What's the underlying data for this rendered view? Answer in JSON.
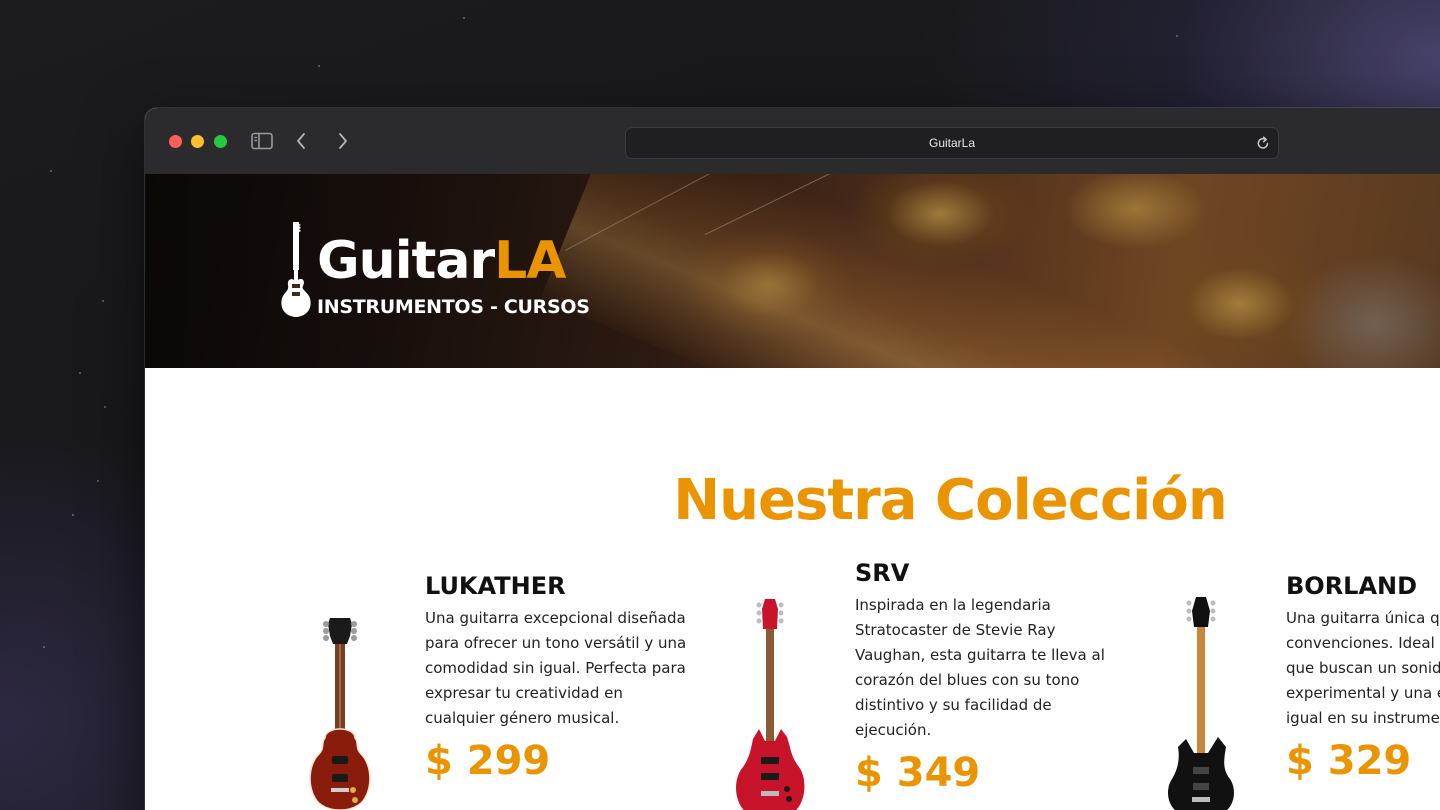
{
  "browser": {
    "address": "GuitarLa"
  },
  "header": {
    "logo_brand": "Guitar",
    "logo_accent": "LA",
    "logo_tagline": "INSTRUMENTOS - CURSOS"
  },
  "main": {
    "title": "Nuestra Colección",
    "products": [
      {
        "name": "LUKATHER",
        "description": "Una guitarra excepcional diseñada para ofrecer un tono versátil y una comodidad sin igual. Perfecta para expresar tu creatividad en cualquier género musical.",
        "price": "$ 299",
        "body_color": "#8a1c0c"
      },
      {
        "name": "SRV",
        "description": "Inspirada en la legendaria Stratocaster de Stevie Ray Vaughan, esta guitarra te lleva al corazón del blues con su tono distintivo y su facilidad de ejecución.",
        "price": "$ 349",
        "body_color": "#c8142a"
      },
      {
        "name": "BORLAND",
        "description": "Una guitarra única que desafía las convenciones. Ideal para músicos que buscan un sonido experimental y una estética sin igual en su instrumento.",
        "price": "$ 329",
        "body_color": "#111111"
      }
    ]
  },
  "colors": {
    "accent": "#e99400",
    "titlebar": "#2b2b2d"
  }
}
